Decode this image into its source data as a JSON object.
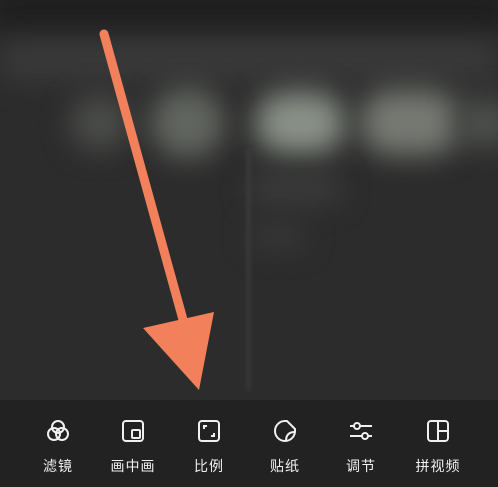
{
  "toolbar": {
    "items": [
      {
        "label": "滤镜",
        "icon": "filter-icon"
      },
      {
        "label": "画中画",
        "icon": "picture-in-picture-icon"
      },
      {
        "label": "比例",
        "icon": "aspect-ratio-icon"
      },
      {
        "label": "贴纸",
        "icon": "sticker-icon"
      },
      {
        "label": "调节",
        "icon": "adjust-sliders-icon"
      },
      {
        "label": "拼视频",
        "icon": "split-layout-icon"
      }
    ]
  },
  "colors": {
    "background": "#2c2c2c",
    "toolbar": "#222222",
    "text": "#f0f0f0",
    "annotation_arrow": "#f2805a"
  }
}
